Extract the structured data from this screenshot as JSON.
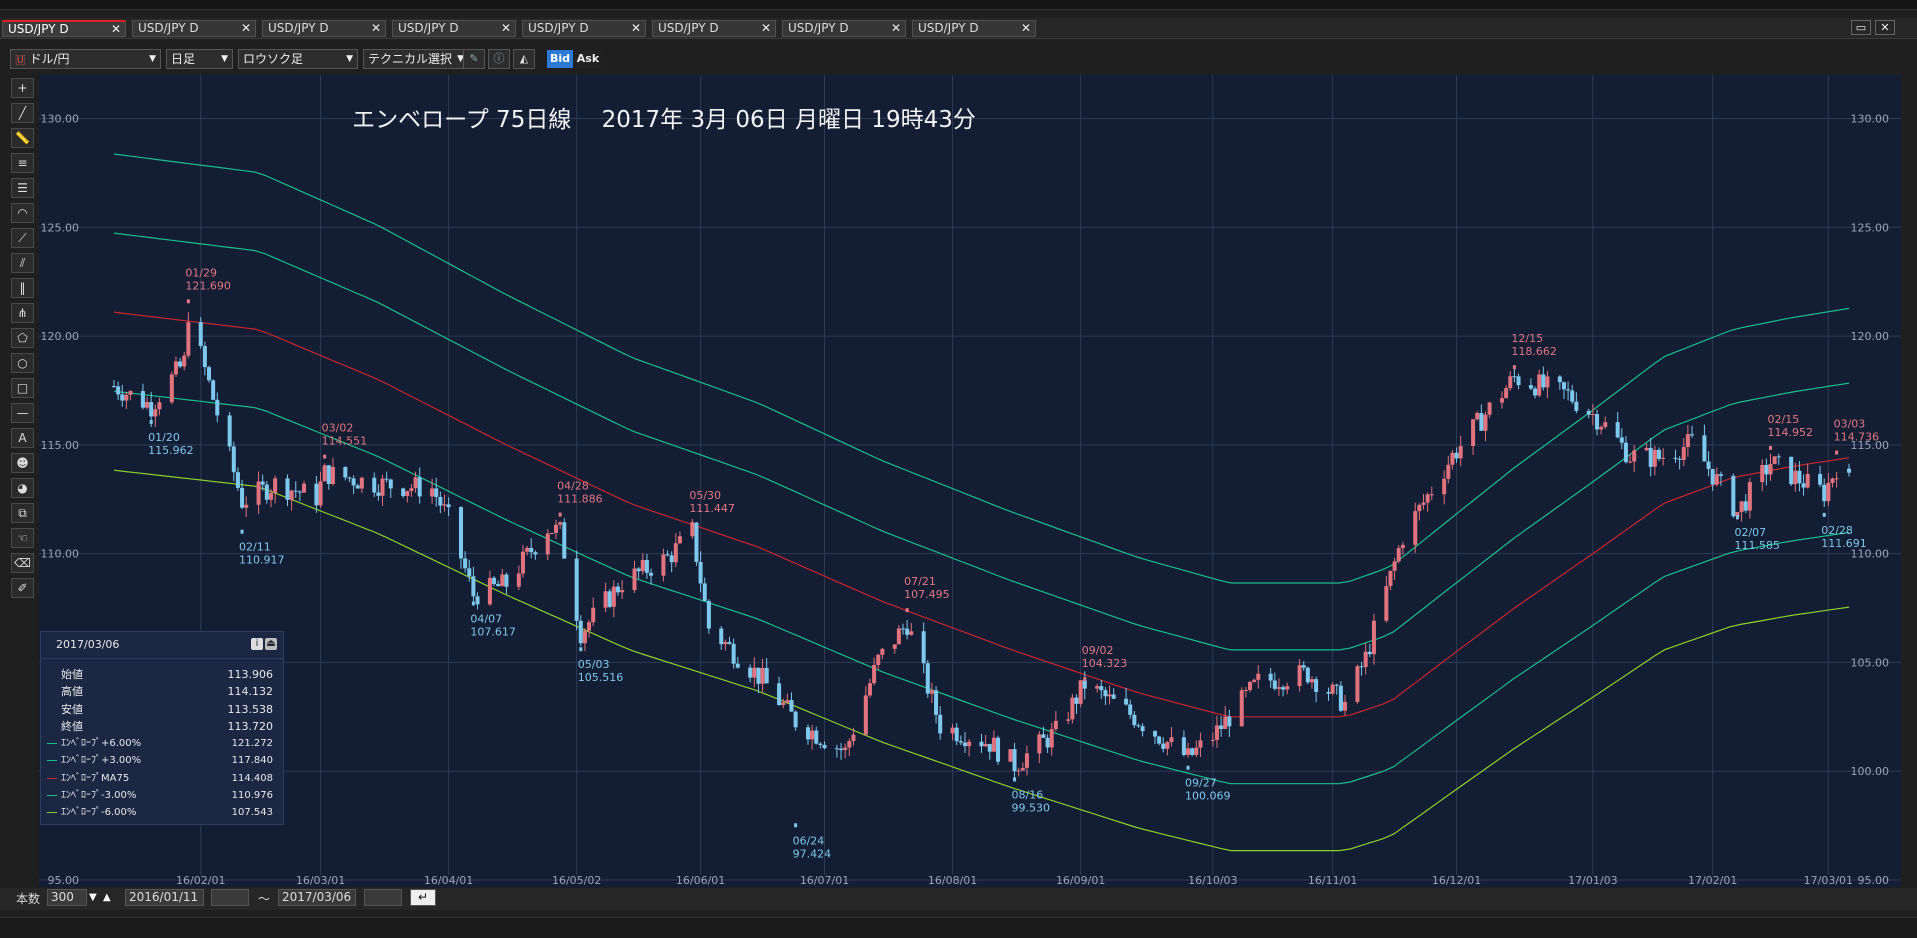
{
  "tabs": [
    {
      "label": "USD/JPY D",
      "active": true
    },
    {
      "label": "USD/JPY D"
    },
    {
      "label": "USD/JPY D"
    },
    {
      "label": "USD/JPY D"
    },
    {
      "label": "USD/JPY D"
    },
    {
      "label": "USD/JPY D"
    },
    {
      "label": "USD/JPY D"
    },
    {
      "label": "USD/JPY D"
    }
  ],
  "tab_close": "✕",
  "toolbar": {
    "pair": "ドル/円",
    "timeframe": "日足",
    "chart_type": "ロウソク足",
    "technical": "テクニカル選択",
    "bid": "Bid",
    "ask": "Ask"
  },
  "chart_title": "エンベロープ 75日線　 2017年 3月 06日 月曜日  19時43分",
  "info_panel": {
    "date": "2017/03/06",
    "rows": [
      {
        "label": "始値",
        "value": "113.906"
      },
      {
        "label": "高値",
        "value": "114.132"
      },
      {
        "label": "安値",
        "value": "113.538"
      },
      {
        "label": "終値",
        "value": "113.720"
      }
    ],
    "indicators": [
      {
        "label": "ｴﾝﾍﾞﾛｰﾌﾟ+6.00%",
        "value": "121.272",
        "color": "#18c08a"
      },
      {
        "label": "ｴﾝﾍﾞﾛｰﾌﾟ+3.00%",
        "value": "117.840",
        "color": "#18c08a"
      },
      {
        "label": "ｴﾝﾍﾞﾛｰﾌﾟMA75",
        "value": "114.408",
        "color": "#c8262c"
      },
      {
        "label": "ｴﾝﾍﾞﾛｰﾌﾟ-3.00%",
        "value": "110.976",
        "color": "#18c08a"
      },
      {
        "label": "ｴﾝﾍﾞﾛｰﾌﾟ-6.00%",
        "value": "107.543",
        "color": "#8ad22a"
      }
    ]
  },
  "bottom": {
    "count_label": "本数",
    "count": "300",
    "from": "2016/01/11",
    "tilde": "～",
    "to": "2017/03/06"
  },
  "colors": {
    "background": "#131d33",
    "grid": "#2e3b57",
    "bull": "#e0737d",
    "bear": "#7ec8ee",
    "ma": "#c8262c",
    "env3": "#18c08a",
    "env6": "#8ad22a",
    "high_label": "#e27882",
    "low_label": "#7ec8ee"
  },
  "chart_data": {
    "type": "candlestick",
    "symbol": "USD/JPY",
    "ylim": [
      95,
      132
    ],
    "yticks": [
      "95.00",
      "100.00",
      "105.00",
      "110.00",
      "115.00",
      "120.00",
      "125.00",
      "130.00"
    ],
    "xticks": [
      {
        "date": "2016-02-01",
        "label": "16/02/01"
      },
      {
        "date": "2016-03-01",
        "label": "16/03/01"
      },
      {
        "date": "2016-04-01",
        "label": "16/04/01"
      },
      {
        "date": "2016-05-02",
        "label": "16/05/02"
      },
      {
        "date": "2016-06-01",
        "label": "16/06/01"
      },
      {
        "date": "2016-07-01",
        "label": "16/07/01"
      },
      {
        "date": "2016-08-01",
        "label": "16/08/01"
      },
      {
        "date": "2016-09-01",
        "label": "16/09/01"
      },
      {
        "date": "2016-10-03",
        "label": "16/10/03"
      },
      {
        "date": "2016-11-01",
        "label": "16/11/01"
      },
      {
        "date": "2016-12-01",
        "label": "16/12/01"
      },
      {
        "date": "2017-01-03",
        "label": "17/01/03"
      },
      {
        "date": "2017-02-01",
        "label": "17/02/01"
      },
      {
        "date": "2017-03-01",
        "label": "17/03/01"
      }
    ],
    "close_path": [
      [
        "2016-01-11",
        117.7
      ],
      [
        "2016-01-20",
        116.8
      ],
      [
        "2016-01-28",
        118.8
      ],
      [
        "2016-01-29",
        121.1
      ],
      [
        "2016-02-03",
        117.8
      ],
      [
        "2016-02-11",
        112.4
      ],
      [
        "2016-02-19",
        113.2
      ],
      [
        "2016-02-29",
        112.6
      ],
      [
        "2016-03-02",
        113.7
      ],
      [
        "2016-03-15",
        113.2
      ],
      [
        "2016-03-28",
        113.0
      ],
      [
        "2016-04-01",
        111.6
      ],
      [
        "2016-04-07",
        108.1
      ],
      [
        "2016-04-15",
        108.6
      ],
      [
        "2016-04-25",
        111.2
      ],
      [
        "2016-04-28",
        111.0
      ],
      [
        "2016-05-03",
        106.4
      ],
      [
        "2016-05-13",
        108.7
      ],
      [
        "2016-05-24",
        109.8
      ],
      [
        "2016-05-30",
        111.0
      ],
      [
        "2016-06-03",
        106.6
      ],
      [
        "2016-06-16",
        104.2
      ],
      [
        "2016-06-24",
        102.3
      ],
      [
        "2016-07-06",
        100.9
      ],
      [
        "2016-07-14",
        105.1
      ],
      [
        "2016-07-21",
        106.8
      ],
      [
        "2016-07-29",
        102.1
      ],
      [
        "2016-08-10",
        101.3
      ],
      [
        "2016-08-16",
        100.3
      ],
      [
        "2016-08-26",
        101.8
      ],
      [
        "2016-09-02",
        104.0
      ],
      [
        "2016-09-14",
        102.5
      ],
      [
        "2016-09-27",
        100.6
      ],
      [
        "2016-10-03",
        101.6
      ],
      [
        "2016-10-14",
        104.1
      ],
      [
        "2016-10-26",
        104.5
      ],
      [
        "2016-11-04",
        103.1
      ],
      [
        "2016-11-09",
        105.2
      ],
      [
        "2016-11-18",
        110.8
      ],
      [
        "2016-11-30",
        114.5
      ],
      [
        "2016-12-15",
        118.1
      ],
      [
        "2016-12-28",
        117.3
      ],
      [
        "2017-01-05",
        116.1
      ],
      [
        "2017-01-12",
        114.5
      ],
      [
        "2017-01-19",
        114.4
      ],
      [
        "2017-01-27",
        115.1
      ],
      [
        "2017-02-07",
        111.9
      ],
      [
        "2017-02-15",
        114.2
      ],
      [
        "2017-02-22",
        113.4
      ],
      [
        "2017-02-28",
        112.8
      ],
      [
        "2017-03-03",
        114.0
      ],
      [
        "2017-03-06",
        113.72
      ]
    ],
    "last_bar": {
      "date": "2017-03-06",
      "open": 113.906,
      "high": 114.132,
      "low": 113.538,
      "close": 113.72
    },
    "annotations": [
      {
        "date": "2016-01-20",
        "value": 115.962,
        "type": "low",
        "date_label": "01/20",
        "value_label": "115.962"
      },
      {
        "date": "2016-01-29",
        "value": 121.69,
        "type": "high",
        "date_label": "01/29",
        "value_label": "121.690"
      },
      {
        "date": "2016-02-11",
        "value": 110.917,
        "type": "low",
        "date_label": "02/11",
        "value_label": "110.917"
      },
      {
        "date": "2016-03-02",
        "value": 114.551,
        "type": "high",
        "date_label": "03/02",
        "value_label": "114.551"
      },
      {
        "date": "2016-04-07",
        "value": 107.617,
        "type": "low",
        "date_label": "04/07",
        "value_label": "107.617"
      },
      {
        "date": "2016-04-28",
        "value": 111.886,
        "type": "high",
        "date_label": "04/28",
        "value_label": "111.886"
      },
      {
        "date": "2016-05-03",
        "value": 105.516,
        "type": "low",
        "date_label": "05/03",
        "value_label": "105.516"
      },
      {
        "date": "2016-05-30",
        "value": 111.447,
        "type": "high",
        "date_label": "05/30",
        "value_label": "111.447"
      },
      {
        "date": "2016-06-24",
        "value": 97.424,
        "type": "low",
        "date_label": "06/24",
        "value_label": "97.424"
      },
      {
        "date": "2016-07-21",
        "value": 107.495,
        "type": "high",
        "date_label": "07/21",
        "value_label": "107.495"
      },
      {
        "date": "2016-08-16",
        "value": 99.53,
        "type": "low",
        "date_label": "08/16",
        "value_label": "99.530"
      },
      {
        "date": "2016-09-02",
        "value": 104.323,
        "type": "high",
        "date_label": "09/02",
        "value_label": "104.323"
      },
      {
        "date": "2016-09-27",
        "value": 100.069,
        "type": "low",
        "date_label": "09/27",
        "value_label": "100.069"
      },
      {
        "date": "2016-12-15",
        "value": 118.662,
        "type": "high",
        "date_label": "12/15",
        "value_label": "118.662"
      },
      {
        "date": "2017-02-07",
        "value": 111.585,
        "type": "low",
        "date_label": "02/07",
        "value_label": "111.585"
      },
      {
        "date": "2017-02-15",
        "value": 114.952,
        "type": "high",
        "date_label": "02/15",
        "value_label": "114.952"
      },
      {
        "date": "2017-02-28",
        "value": 111.691,
        "type": "low",
        "date_label": "02/28",
        "value_label": "111.691"
      },
      {
        "date": "2017-03-03",
        "value": 114.736,
        "type": "high",
        "date_label": "03/03",
        "value_label": "114.736"
      }
    ],
    "envelopes": [
      {
        "name": "ｴﾝﾍﾞﾛｰﾌﾟ+6.00%",
        "offset": 0.06,
        "color": "#18c08a",
        "last": 121.272
      },
      {
        "name": "ｴﾝﾍﾞﾛｰﾌﾟ+3.00%",
        "offset": 0.03,
        "color": "#18c08a",
        "last": 117.84
      },
      {
        "name": "ｴﾝﾍﾞﾛｰﾌﾟMA75",
        "offset": 0.0,
        "color": "#c8262c",
        "last": 114.408
      },
      {
        "name": "ｴﾝﾍﾞﾛｰﾌﾟ-3.00%",
        "offset": -0.03,
        "color": "#18c08a",
        "last": 110.976
      },
      {
        "name": "ｴﾝﾍﾞﾛｰﾌﾟ-6.00%",
        "offset": -0.06,
        "color": "#8ad22a",
        "last": 107.543
      }
    ],
    "ma_path": [
      [
        "2016-01-11",
        121.1
      ],
      [
        "2016-02-15",
        120.3
      ],
      [
        "2016-03-15",
        118.0
      ],
      [
        "2016-04-15",
        115.0
      ],
      [
        "2016-05-15",
        112.3
      ],
      [
        "2016-06-15",
        110.3
      ],
      [
        "2016-07-15",
        107.8
      ],
      [
        "2016-08-15",
        105.6
      ],
      [
        "2016-09-15",
        103.6
      ],
      [
        "2016-10-07",
        102.5
      ],
      [
        "2016-11-04",
        102.5
      ],
      [
        "2016-11-15",
        103.2
      ],
      [
        "2016-12-01",
        105.5
      ],
      [
        "2016-12-15",
        107.5
      ],
      [
        "2017-01-03",
        110.0
      ],
      [
        "2017-01-20",
        112.3
      ],
      [
        "2017-02-06",
        113.5
      ],
      [
        "2017-02-20",
        114.0
      ],
      [
        "2017-03-06",
        114.408
      ]
    ]
  }
}
